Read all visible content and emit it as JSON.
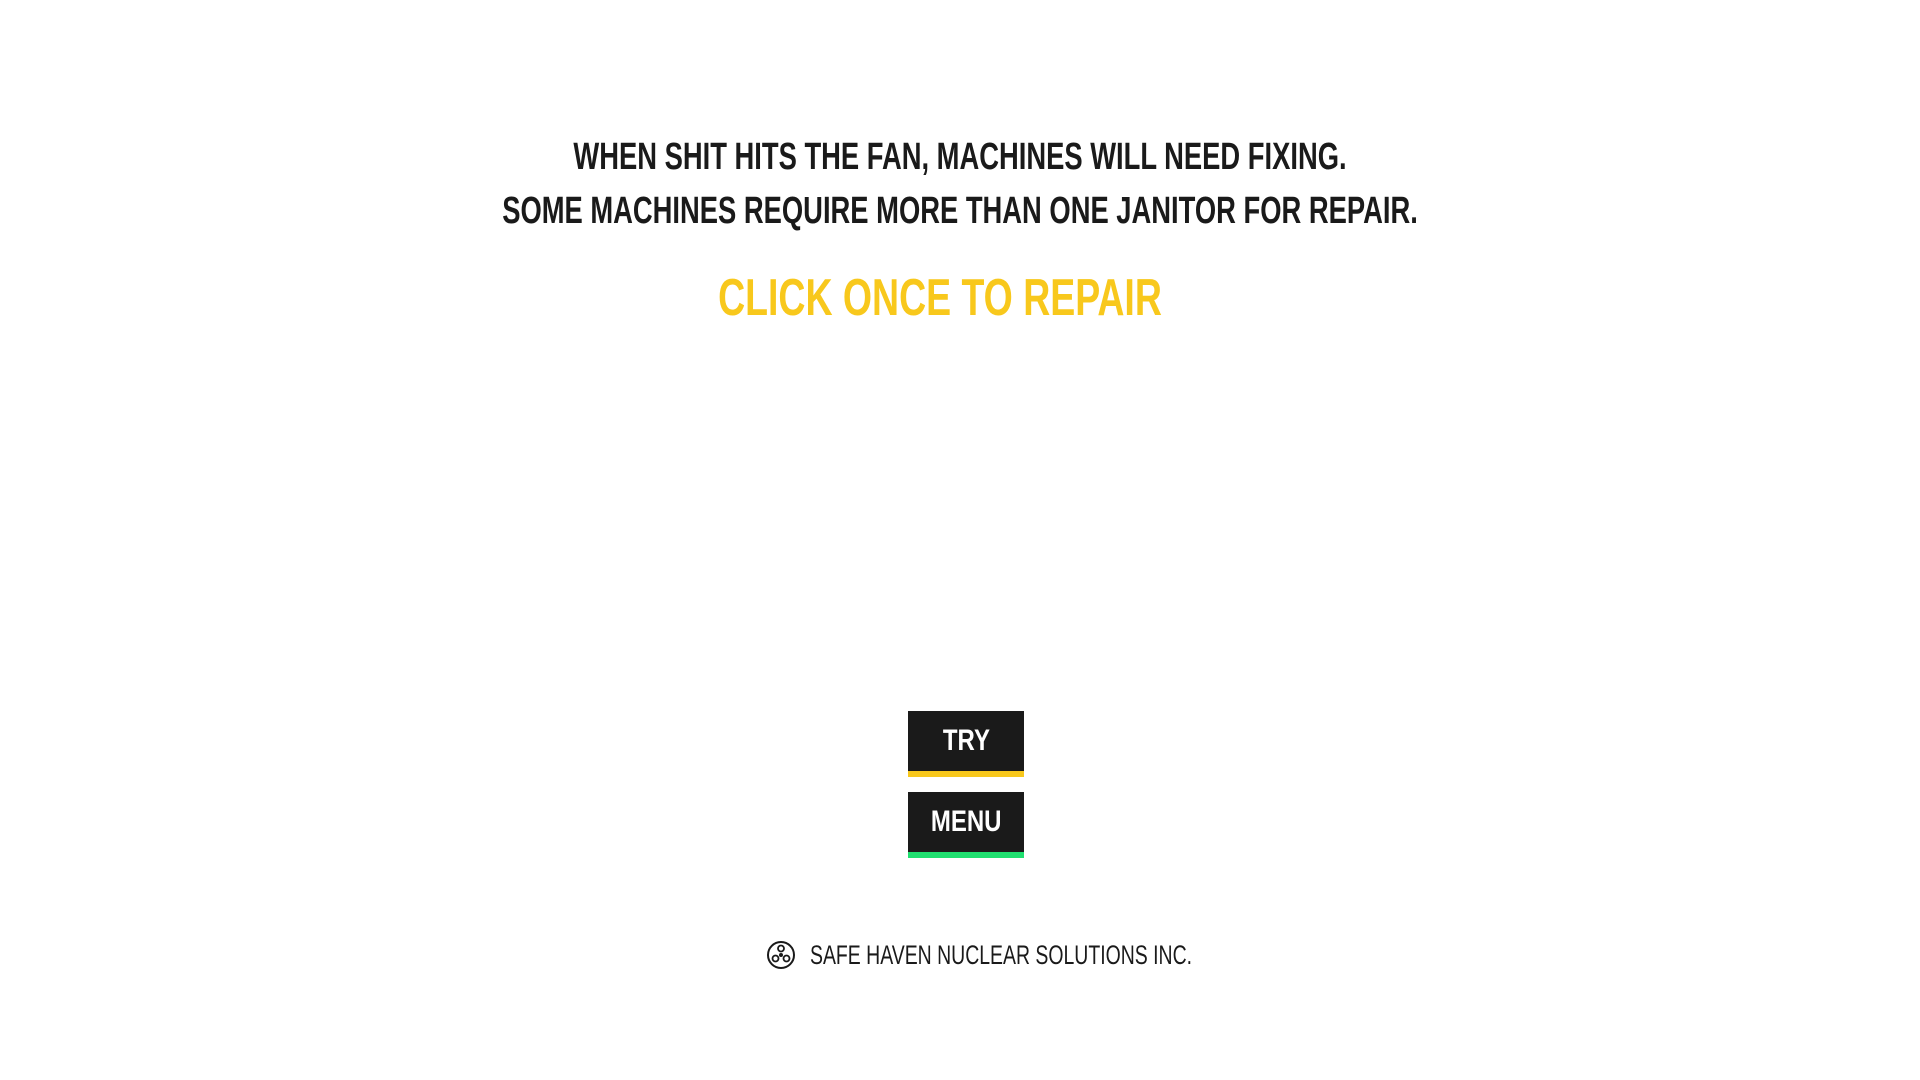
{
  "intro": {
    "line1": "WHEN SHIT HITS THE FAN, MACHINES WILL NEED FIXING.",
    "line2": "SOME MACHINES REQUIRE MORE THAN ONE JANITOR FOR REPAIR."
  },
  "instruction": "CLICK ONCE TO REPAIR",
  "buttons": {
    "try_label": "TRY",
    "menu_label": "MENU"
  },
  "footer": {
    "company": "SAFE HAVEN NUCLEAR SOLUTIONS INC.",
    "icon": "radiation-icon"
  },
  "colors": {
    "accent_yellow": "#f8c81c",
    "accent_green": "#20e070",
    "text_dark": "#1a1a1a",
    "background": "#ffffff"
  }
}
